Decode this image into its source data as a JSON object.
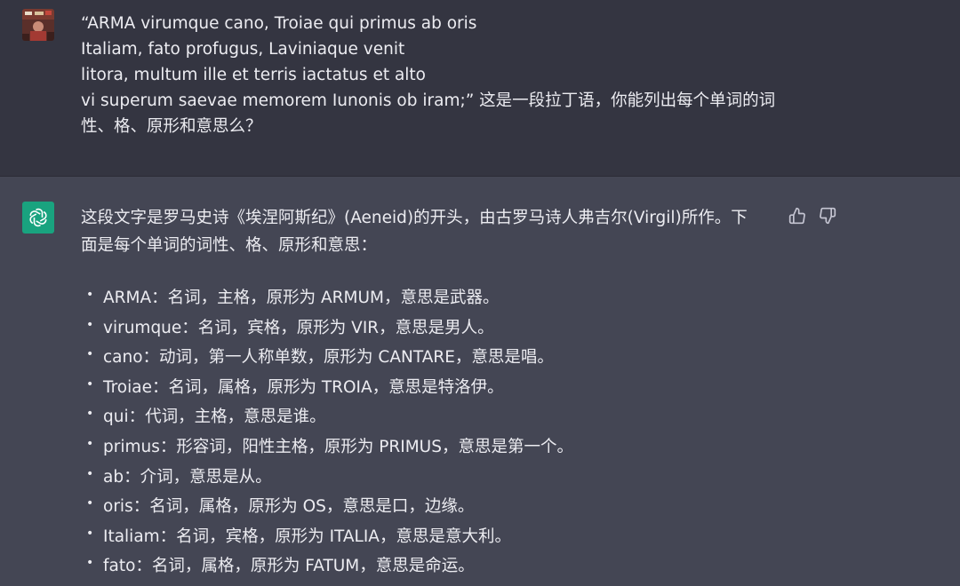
{
  "user_message": {
    "lines": [
      "“ARMA virumque cano, Troiae qui primus ab oris",
      "Italiam, fato profugus, Laviniaque venit",
      "litora, multum ille et terris iactatus et alto",
      "vi superum saevae memorem Iunonis ob iram;” 这是一段拉丁语，你能列出每个单词的词",
      "性、格、原形和意思么？"
    ]
  },
  "assistant_message": {
    "intro_lines": [
      "这段文字是罗马史诗《埃涅阿斯纪》(Aeneid)的开头，由古罗马诗人弗吉尔(Virgil)所作。下",
      "面是每个单词的词性、格、原形和意思："
    ],
    "items": [
      "ARMA：名词，主格，原形为 ARMUM，意思是武器。",
      "virumque：名词，宾格，原形为 VIR，意思是男人。",
      "cano：动词，第一人称单数，原形为 CANTARE，意思是唱。",
      "Troiae：名词，属格，原形为 TROIA，意思是特洛伊。",
      "qui：代词，主格，意思是谁。",
      "primus：形容词，阳性主格，原形为 PRIMUS，意思是第一个。",
      "ab：介词，意思是从。",
      "oris：名词，属格，原形为 OS，意思是口，边缘。",
      "Italiam：名词，宾格，原形为 ITALIA，意思是意大利。",
      "fato：名词，属格，原形为 FATUM，意思是命运。"
    ],
    "bullet": "•"
  },
  "icons": {
    "user_avatar": "user-avatar-photo",
    "assistant_avatar": "openai-logo-icon",
    "feedback_up": "thumbs-up-icon",
    "feedback_down": "thumbs-down-icon"
  },
  "colors": {
    "user_bg": "#343541",
    "assistant_bg": "#444654",
    "text": "#ececf1",
    "openai_green": "#19a37f"
  }
}
